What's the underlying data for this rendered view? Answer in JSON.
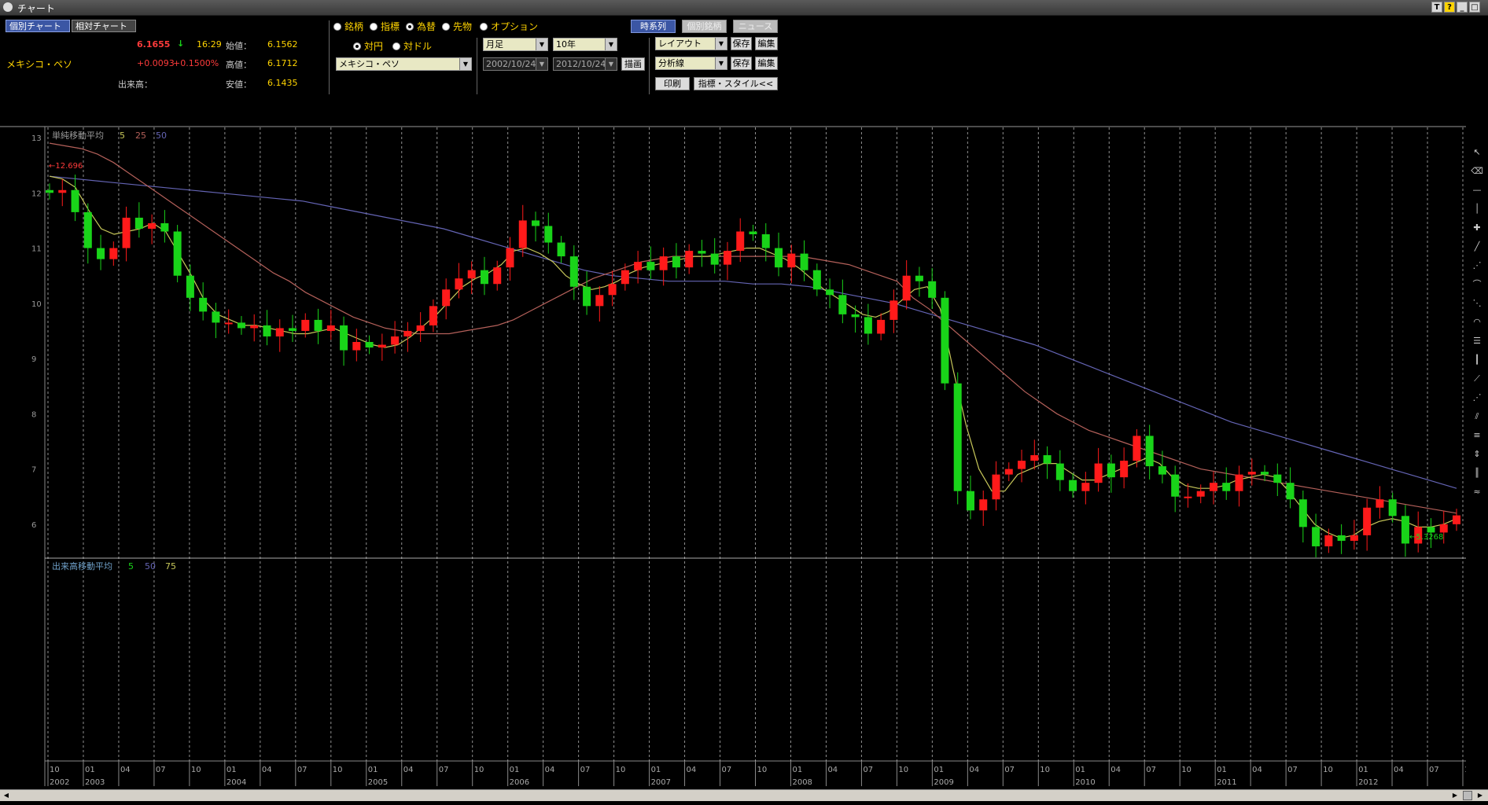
{
  "window": {
    "title": "チャート"
  },
  "tabs": [
    {
      "label": "個別チャート",
      "active": true
    },
    {
      "label": "相対チャート",
      "active": false
    }
  ],
  "quote": {
    "name": "メキシコ・ペソ",
    "price": "6.1655",
    "arrow": "↓",
    "time": "16:29",
    "change": "+0.0093",
    "change_pct": "+0.1500%",
    "volume_label": "出来高：",
    "open_label": "始値：",
    "open": "6.1562",
    "high_label": "高値：",
    "high": "6.1712",
    "low_label": "安値：",
    "low": "6.1435"
  },
  "asset_types": [
    {
      "label": "銘柄",
      "selected": false
    },
    {
      "label": "指標",
      "selected": false
    },
    {
      "label": "為替",
      "selected": true
    },
    {
      "label": "先物",
      "selected": false
    },
    {
      "label": "オプション",
      "selected": false
    }
  ],
  "fx_base": [
    {
      "label": "対円",
      "selected": true
    },
    {
      "label": "対ドル",
      "selected": false
    }
  ],
  "currency_select": "メキシコ・ペソ",
  "period_select": "月足",
  "span_select": "10年",
  "date_from": "2002/10/24",
  "date_to": "2012/10/24",
  "draw_button": "描画",
  "top_buttons": {
    "timeseries": "時系列",
    "individual": "個別銘柄",
    "news": "ニュース"
  },
  "layout_select": "レイアウト",
  "analysis_select": "分析線",
  "save_label": "保存",
  "edit_label": "編集",
  "print_label": "印刷",
  "indicator_style_label": "指標・スタイル<<",
  "colors": {
    "up": "#ff1a1a",
    "down": "#19d419",
    "ma5": "#c8c85a",
    "ma25": "#b4605a",
    "ma50": "#6464b4",
    "grid": "#cccccc"
  },
  "chart_data": {
    "type": "candlestick",
    "main_legend": {
      "title": "単純移動平均",
      "periods": [
        "5",
        "25",
        "50"
      ]
    },
    "volume_legend": {
      "title": "出来高移動平均",
      "periods": [
        "5",
        "50",
        "75"
      ]
    },
    "y_ticks": [
      "13",
      "12",
      "11",
      "10",
      "9",
      "8",
      "7",
      "6"
    ],
    "y_range": [
      5.4,
      13.2
    ],
    "high_marker": "←12.696",
    "low_marker": "←5.3268",
    "x_month_labels": [
      "10",
      "01",
      "04",
      "07",
      "10",
      "01",
      "04",
      "07",
      "10",
      "01",
      "04",
      "07",
      "10",
      "01",
      "04",
      "07",
      "10",
      "01",
      "04",
      "07",
      "10",
      "01",
      "04",
      "07",
      "10",
      "01",
      "04",
      "07",
      "10",
      "01",
      "04",
      "07",
      "10",
      "01",
      "04",
      "07",
      "10",
      "01",
      "04",
      "07",
      "10"
    ],
    "x_year_labels": [
      "2002",
      "2003",
      "2004",
      "2005",
      "2006",
      "2007",
      "2008",
      "2009",
      "2010",
      "2011",
      "2012"
    ],
    "closes": [
      12.0,
      12.05,
      11.65,
      11.0,
      10.8,
      11.0,
      11.55,
      11.35,
      11.45,
      11.3,
      10.5,
      10.1,
      9.85,
      9.65,
      9.65,
      9.55,
      9.6,
      9.4,
      9.55,
      9.5,
      9.7,
      9.5,
      9.6,
      9.15,
      9.3,
      9.2,
      9.25,
      9.4,
      9.5,
      9.6,
      9.95,
      10.25,
      10.45,
      10.6,
      10.35,
      10.65,
      11.0,
      11.5,
      11.4,
      11.1,
      10.85,
      10.3,
      9.95,
      10.15,
      10.35,
      10.6,
      10.75,
      10.6,
      10.85,
      10.65,
      10.95,
      10.9,
      10.7,
      10.95,
      11.3,
      11.25,
      11.0,
      10.65,
      10.9,
      10.6,
      10.25,
      10.15,
      9.8,
      9.75,
      9.45,
      9.7,
      10.05,
      10.5,
      10.4,
      10.1,
      8.55,
      6.6,
      6.25,
      6.45,
      6.9,
      7.0,
      7.15,
      7.25,
      7.1,
      6.8,
      6.6,
      6.75,
      7.1,
      6.85,
      7.15,
      7.6,
      7.05,
      6.9,
      6.5,
      6.5,
      6.6,
      6.75,
      6.6,
      6.9,
      6.95,
      6.9,
      6.75,
      6.45,
      5.95,
      5.6,
      5.8,
      5.7,
      5.8,
      6.3,
      6.45,
      6.15,
      5.65,
      5.95,
      5.85,
      6.0,
      6.16
    ],
    "ma5": [
      12.3,
      12.25,
      12.1,
      11.7,
      11.35,
      11.25,
      11.3,
      11.35,
      11.45,
      11.3,
      10.9,
      10.5,
      10.05,
      9.8,
      9.7,
      9.6,
      9.6,
      9.55,
      9.5,
      9.45,
      9.45,
      9.5,
      9.55,
      9.45,
      9.35,
      9.25,
      9.2,
      9.25,
      9.4,
      9.6,
      9.8,
      10.05,
      10.3,
      10.45,
      10.55,
      10.7,
      10.95,
      11.0,
      10.9,
      10.75,
      10.5,
      10.35,
      10.25,
      10.3,
      10.4,
      10.55,
      10.65,
      10.7,
      10.75,
      10.8,
      10.85,
      10.85,
      10.9,
      10.95,
      11.0,
      11.0,
      10.9,
      10.8,
      10.65,
      10.45,
      10.25,
      10.1,
      9.95,
      9.8,
      9.75,
      9.85,
      10.05,
      10.25,
      10.3,
      9.9,
      8.8,
      7.8,
      7.0,
      6.6,
      6.6,
      6.9,
      7.0,
      7.1,
      7.1,
      6.95,
      6.8,
      6.8,
      6.9,
      7.0,
      7.1,
      7.2,
      7.1,
      6.85,
      6.7,
      6.65,
      6.65,
      6.7,
      6.8,
      6.85,
      6.9,
      6.85,
      6.6,
      6.3,
      6.0,
      5.85,
      5.75,
      5.8,
      5.95,
      6.05,
      6.1,
      6.05,
      5.95,
      5.95,
      6.0,
      6.1
    ],
    "ma25": [
      12.9,
      12.85,
      12.8,
      12.7,
      12.55,
      12.35,
      12.15,
      11.95,
      11.75,
      11.55,
      11.35,
      11.15,
      10.95,
      10.75,
      10.55,
      10.4,
      10.2,
      10.05,
      9.9,
      9.75,
      9.65,
      9.55,
      9.5,
      9.45,
      9.45,
      9.45,
      9.5,
      9.55,
      9.6,
      9.7,
      9.85,
      10.0,
      10.15,
      10.3,
      10.45,
      10.55,
      10.65,
      10.75,
      10.8,
      10.85,
      10.85,
      10.85,
      10.85,
      10.85,
      10.85,
      10.85,
      10.85,
      10.85,
      10.8,
      10.75,
      10.7,
      10.6,
      10.5,
      10.4,
      10.1,
      9.9,
      9.65,
      9.4,
      9.15,
      8.9,
      8.65,
      8.4,
      8.2,
      8.0,
      7.85,
      7.7,
      7.6,
      7.5,
      7.4,
      7.3,
      7.2,
      7.1,
      7.0,
      6.95,
      6.9,
      6.85,
      6.8,
      6.75,
      6.7,
      6.65,
      6.6,
      6.55,
      6.5,
      6.45,
      6.4,
      6.35,
      6.3,
      6.25,
      6.2
    ],
    "ma50": [
      12.3,
      12.25,
      12.2,
      12.15,
      12.1,
      12.05,
      12.0,
      11.95,
      11.9,
      11.85,
      11.75,
      11.65,
      11.55,
      11.45,
      11.35,
      11.2,
      11.05,
      10.9,
      10.75,
      10.6,
      10.5,
      10.45,
      10.4,
      10.4,
      10.4,
      10.35,
      10.35,
      10.3,
      10.2,
      10.1,
      10.0,
      9.85,
      9.7,
      9.55,
      9.4,
      9.25,
      9.05,
      8.85,
      8.65,
      8.45,
      8.25,
      8.05,
      7.85,
      7.7,
      7.55,
      7.4,
      7.25,
      7.1,
      6.95,
      6.8,
      6.65
    ]
  }
}
